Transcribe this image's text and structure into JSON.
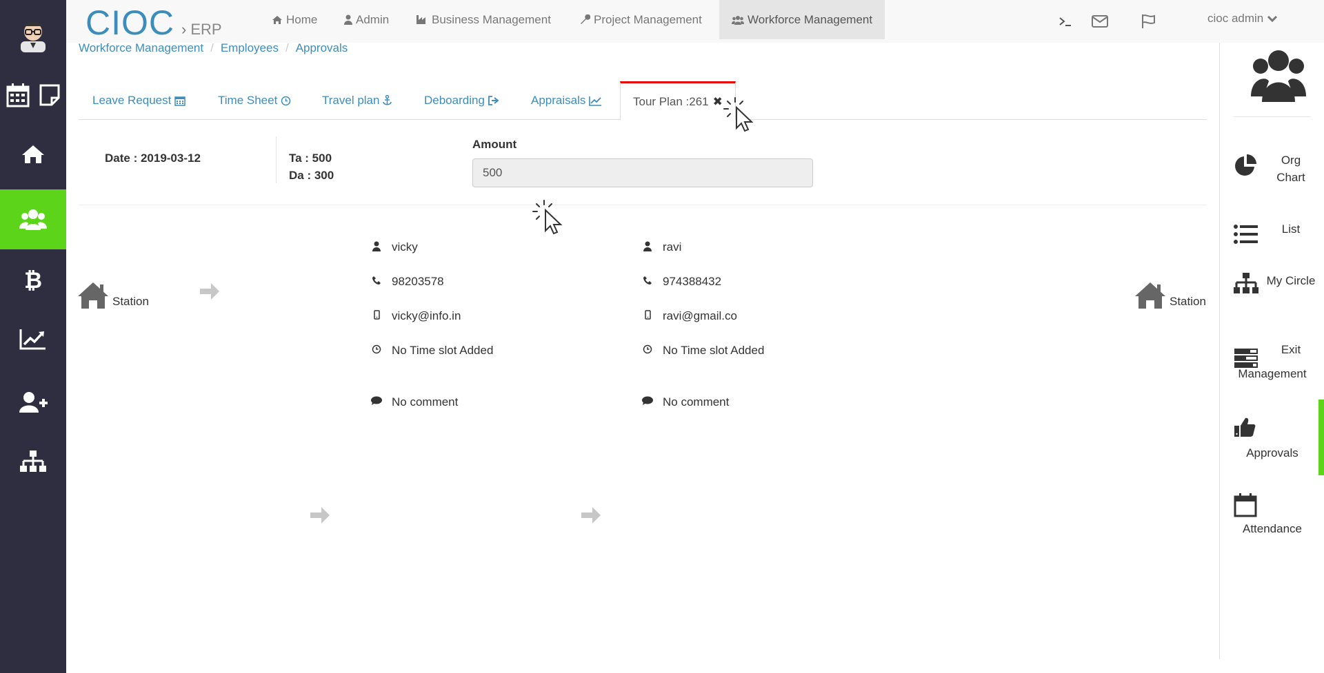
{
  "brand": {
    "name": "CIOC",
    "chevron": "›",
    "sub": "ERP"
  },
  "nav": {
    "items": [
      {
        "label": "Home",
        "icon": "home-icon"
      },
      {
        "label": "Admin",
        "icon": "user-icon"
      },
      {
        "label": "Business Management",
        "icon": "industry-icon"
      },
      {
        "label": "Project Management",
        "icon": "wrench-icon"
      },
      {
        "label": "Workforce Management",
        "icon": "users-icon",
        "active": true
      }
    ],
    "terminal_icon": "terminal-icon",
    "mail_icon": "envelope-icon",
    "flag_icon": "flag-icon",
    "user": "cioc admin"
  },
  "breadcrumb": [
    "Workforce Management",
    "Employees",
    "Approvals"
  ],
  "tabs": [
    {
      "label": "Leave Request",
      "icon": "calendar-icon"
    },
    {
      "label": "Time Sheet",
      "icon": "clock-icon"
    },
    {
      "label": "Travel plan",
      "icon": "anchor-icon"
    },
    {
      "label": "Deboarding",
      "icon": "sign-out-icon"
    },
    {
      "label": "Appraisals",
      "icon": "line-chart-icon"
    },
    {
      "label": "Tour Plan :261",
      "icon": "close-icon",
      "active": true
    }
  ],
  "summary": {
    "date": "Date : 2019-03-12",
    "ta": "Ta : 500",
    "da": "Da : 300",
    "amount_label": "Amount",
    "amount_value": "500"
  },
  "route": {
    "start_station": "Station",
    "end_station": "Station",
    "people": [
      {
        "name": "vicky",
        "phone": "98203578",
        "email": "vicky@info.in",
        "time": "No Time slot Added",
        "comment": "No comment"
      },
      {
        "name": "ravi",
        "phone": "974388432",
        "email": "ravi@gmail.co",
        "time": "No Time slot Added",
        "comment": "No comment"
      }
    ]
  },
  "right_sidebar": {
    "items": [
      {
        "label": "Org Chart",
        "icon": "pie-chart-icon"
      },
      {
        "label": "List",
        "icon": "list-icon"
      },
      {
        "label": "My Circle",
        "icon": "sitemap-icon"
      },
      {
        "label": "Exit Management",
        "icon": "tasks-icon"
      },
      {
        "label": "Approvals",
        "icon": "thumbs-up-icon"
      },
      {
        "label": "Attendance",
        "icon": "calendar-icon"
      }
    ]
  },
  "colors": {
    "sidebar": "#2f2e41",
    "accent_green": "#5bd41a",
    "link": "#3c8dbc",
    "tab_active_border": "#e60000"
  }
}
